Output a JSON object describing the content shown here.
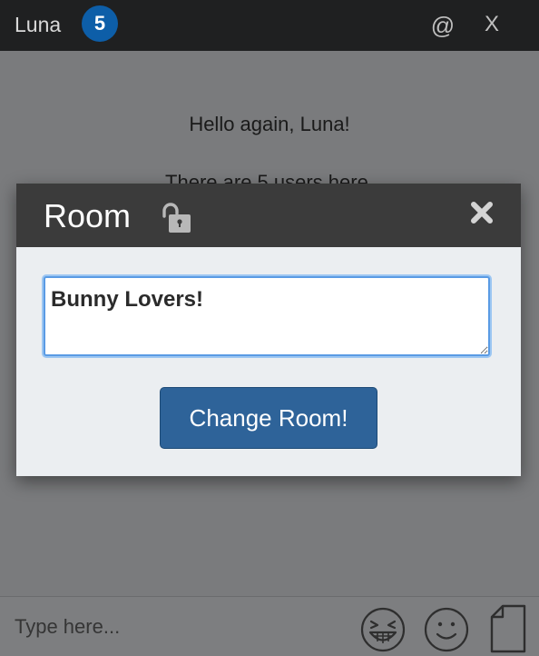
{
  "header": {
    "username": "Luna",
    "user_count_badge": "5",
    "mention_label": "@",
    "close_label": "X"
  },
  "messages": {
    "greeting": "Hello again, Luna!",
    "user_count": "There are 5 users here."
  },
  "modal": {
    "title": "Room",
    "room_name_value": "Bunny Lovers!",
    "submit_label": "Change Room!"
  },
  "composer": {
    "placeholder": "Type here..."
  },
  "colors": {
    "badge": "#0d5ea8",
    "button": "#2e6399",
    "header": "#1f2021",
    "modal_header": "#3b3b3b"
  },
  "icons": {
    "lock": "unlocked-lock-icon",
    "close": "close-x-icon",
    "emoji_laugh": "laughing-face-icon",
    "emoji_smile": "smiling-face-icon",
    "file": "document-icon"
  }
}
